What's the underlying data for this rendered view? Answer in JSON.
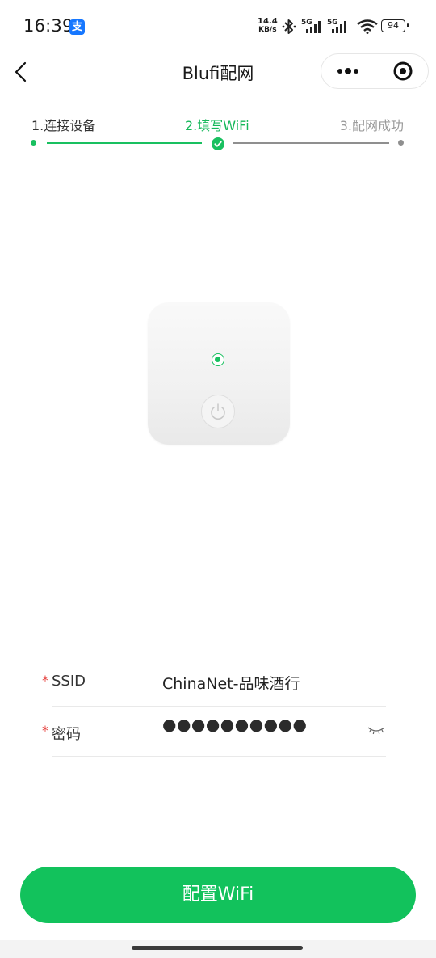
{
  "status_bar": {
    "time": "16:39",
    "net_speed_value": "14.4",
    "net_speed_unit": "KB/s",
    "signal_1_label": "5G",
    "signal_2_label": "5G",
    "battery": "94",
    "icons": [
      "alipay-icon",
      "bluetooth-icon",
      "signal-icon",
      "wifi-icon",
      "battery-icon"
    ]
  },
  "nav": {
    "title": "Blufi配网",
    "back_icon": "chevron-left-icon",
    "more_icon": "more-icon",
    "close_icon": "target-icon"
  },
  "steps": {
    "items": [
      {
        "label": "1.连接设备",
        "state": "done"
      },
      {
        "label": "2.填写WiFi",
        "state": "current"
      },
      {
        "label": "3.配网成功",
        "state": "pending"
      }
    ],
    "progress_fraction": 0.5
  },
  "device": {
    "led_status": "on",
    "power_icon": "power-icon"
  },
  "form": {
    "ssid": {
      "required_mark": "*",
      "label": "SSID",
      "value": "ChinaNet-品味酒行"
    },
    "password": {
      "required_mark": "*",
      "label": "密码",
      "value_masked": "●●●●●●●●●●",
      "toggle_icon": "eye-closed-icon"
    }
  },
  "actions": {
    "submit_label": "配置WiFi"
  },
  "colors": {
    "accent": "#12c25c",
    "required": "#e64340",
    "pending": "#9b9b9b"
  }
}
